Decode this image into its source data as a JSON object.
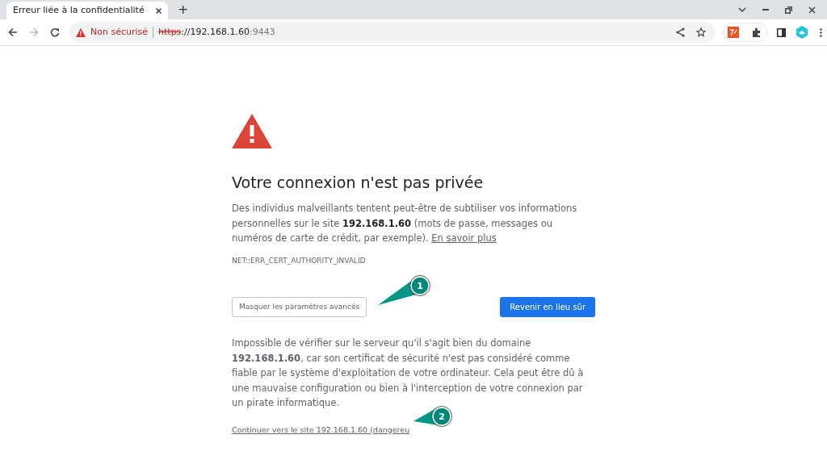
{
  "tabs": [
    {
      "title": "Erreur liée à la confidentialité",
      "selected": true
    }
  ],
  "new_tab": "+",
  "address_bar": {
    "security_label": "Non sécurisé",
    "scheme": "https",
    "host": "://192.168.1.60",
    "port": ":9443"
  },
  "page": {
    "heading": "Votre connexion n'est pas privée",
    "intro": "Des individus malveillants tentent peut-être de subtiliser vos informations personnelles sur le site **192.168.1.60** (mots de passe, messages ou numéros de carte de crédit, par exemple).",
    "learn_more": "En savoir plus",
    "error_code": "NET::ERR_CERT_AUTHORITY_INVALID",
    "advanced_button": "Masquer les paramètres avancés",
    "back_button": "Revenir en lieu sûr",
    "details": "Impossible de vérifier sur le serveur qu'il s'agit bien du domaine **192.168.1.60**, car son certificat de sécurité n'est pas considéré comme fiable par le système d'exploitation de votre ordinateur. Cela peut être dû à une mauvaise configuration ou bien à l'interception de votre connexion par un pirate informatique.",
    "proceed_link": "Continuer vers le site 192.168.1.60 (dangereu"
  },
  "annotations": [
    {
      "number": "1"
    },
    {
      "number": "2"
    }
  ]
}
